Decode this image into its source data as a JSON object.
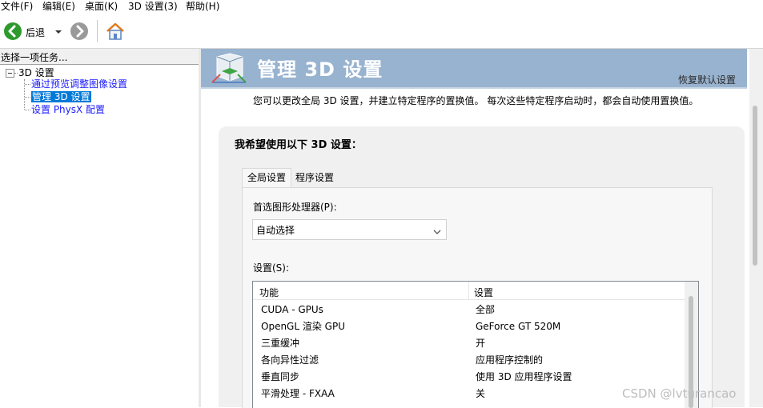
{
  "menu": [
    {
      "label": "文件(F)"
    },
    {
      "label": "编辑(E)"
    },
    {
      "label": "桌面(K)"
    },
    {
      "label": "3D 设置(3)"
    },
    {
      "label": "帮助(H)"
    }
  ],
  "toolbar": {
    "back_label": "后退",
    "icons": [
      "back-arrow-icon",
      "dropdown-arrow-icon",
      "forward-arrow-icon",
      "home-icon"
    ]
  },
  "sidebar": {
    "header": "选择一项任务...",
    "tree_root": "3D 设置",
    "tree_items": [
      {
        "label": "通过预览调整图像设置"
      },
      {
        "label": "管理 3D 设置",
        "selected": true
      },
      {
        "label": "设置 PhysX 配置"
      }
    ]
  },
  "main": {
    "title": "管理 3D 设置",
    "restore_link": "恢复默认设置",
    "description": "您可以更改全局 3D 设置，并建立特定程序的置换值。 每次这些特定程序启动时，都会自动使用置换值。",
    "section_title": "我希望使用以下 3D 设置：",
    "tabs": [
      {
        "label": "全局设置",
        "active": true
      },
      {
        "label": "程序设置",
        "active": false
      }
    ],
    "gpu_label": "首选图形处理器(P):",
    "gpu_value": "自动选择",
    "settings_label": "设置(S):",
    "table": {
      "headers": [
        "功能",
        "设置"
      ],
      "rows": [
        {
          "feature": "CUDA - GPUs",
          "value": "全部"
        },
        {
          "feature": "OpenGL 渲染 GPU",
          "value": "GeForce GT 520M"
        },
        {
          "feature": "三重缓冲",
          "value": "开"
        },
        {
          "feature": "各向异性过滤",
          "value": "应用程序控制的"
        },
        {
          "feature": "垂直同步",
          "value": "使用 3D 应用程序设置"
        },
        {
          "feature": "平滑处理 - FXAA",
          "value": "关"
        }
      ]
    }
  },
  "colors": {
    "banner": "#98b3cf",
    "selection": "#0078d7",
    "link": "#1a1aff",
    "back_button": "#2e9a2e"
  },
  "watermark": "CSDN @lvturancao"
}
